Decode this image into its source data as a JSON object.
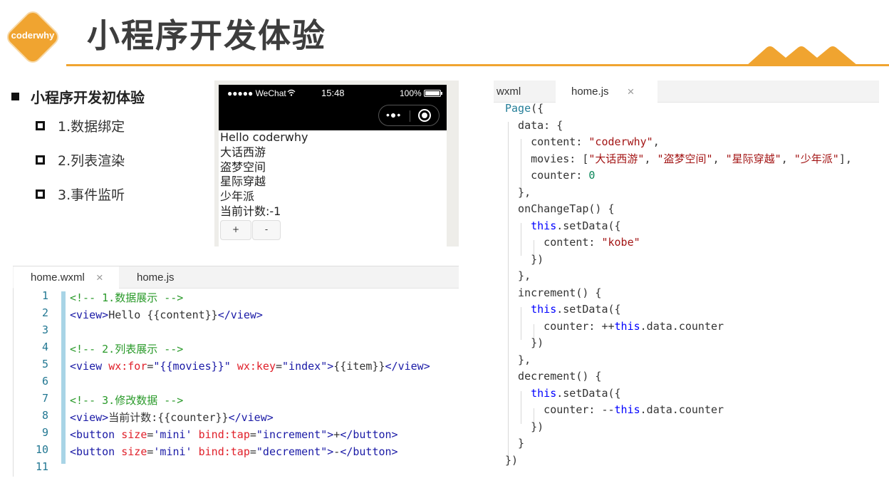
{
  "header": {
    "logo_text": "coderwhy",
    "title": "小程序开发体验",
    "accent_color": "#f0a430"
  },
  "outline": {
    "main": "小程序开发初体验",
    "items": [
      "1.数据绑定",
      "2.列表渲染",
      "3.事件监听"
    ]
  },
  "phone": {
    "carrier": "●●●●● WeChat",
    "wifi_icon": "wifi-icon",
    "time": "15:48",
    "battery": "100%",
    "capsule_dots": "•●•",
    "content_lines": [
      "Hello coderwhy",
      "大话西游",
      "盗梦空间",
      "星际穿越",
      "少年派",
      "当前计数:-1"
    ],
    "buttons": [
      "+",
      "-"
    ]
  },
  "wxml_editor": {
    "tabs": [
      {
        "label": "home.wxml",
        "active": true,
        "close": "×"
      },
      {
        "label": "home.js",
        "active": false
      }
    ],
    "line_numbers": [
      "1",
      "2",
      "3",
      "4",
      "5",
      "6",
      "7",
      "8",
      "9",
      "10",
      "11"
    ],
    "lines": [
      [
        {
          "t": "comment",
          "v": "<!-- 1.数据展示 -->"
        }
      ],
      [
        {
          "t": "tag",
          "v": "<view>"
        },
        {
          "t": "text",
          "v": "Hello {{content}}"
        },
        {
          "t": "tag",
          "v": "</view>"
        }
      ],
      [],
      [
        {
          "t": "comment",
          "v": "<!-- 2.列表展示 -->"
        }
      ],
      [
        {
          "t": "tag",
          "v": "<view "
        },
        {
          "t": "attr",
          "v": "wx:for"
        },
        {
          "t": "text",
          "v": "="
        },
        {
          "t": "str",
          "v": "\"{{movies}}\""
        },
        {
          "t": "text",
          "v": " "
        },
        {
          "t": "attr",
          "v": "wx:key"
        },
        {
          "t": "text",
          "v": "="
        },
        {
          "t": "str",
          "v": "\"index\""
        },
        {
          "t": "tag",
          "v": ">"
        },
        {
          "t": "text",
          "v": "{{item}}"
        },
        {
          "t": "tag",
          "v": "</view>"
        }
      ],
      [],
      [
        {
          "t": "comment",
          "v": "<!-- 3.修改数据 -->"
        }
      ],
      [
        {
          "t": "tag",
          "v": "<view>"
        },
        {
          "t": "text",
          "v": "当前计数:{{counter}}"
        },
        {
          "t": "tag",
          "v": "</view>"
        }
      ],
      [
        {
          "t": "tag",
          "v": "<button "
        },
        {
          "t": "attr",
          "v": "size"
        },
        {
          "t": "text",
          "v": "="
        },
        {
          "t": "str",
          "v": "'mini'"
        },
        {
          "t": "text",
          "v": " "
        },
        {
          "t": "attr",
          "v": "bind:tap"
        },
        {
          "t": "text",
          "v": "="
        },
        {
          "t": "str",
          "v": "\"increment\""
        },
        {
          "t": "tag",
          "v": ">"
        },
        {
          "t": "text",
          "v": "+"
        },
        {
          "t": "tag",
          "v": "</button>"
        }
      ],
      [
        {
          "t": "tag",
          "v": "<button "
        },
        {
          "t": "attr",
          "v": "size"
        },
        {
          "t": "text",
          "v": "="
        },
        {
          "t": "str",
          "v": "'mini'"
        },
        {
          "t": "text",
          "v": " "
        },
        {
          "t": "attr",
          "v": "bind:tap"
        },
        {
          "t": "text",
          "v": "="
        },
        {
          "t": "str",
          "v": "\"decrement\""
        },
        {
          "t": "tag",
          "v": ">"
        },
        {
          "t": "text",
          "v": "-"
        },
        {
          "t": "tag",
          "v": "</button>"
        }
      ],
      []
    ]
  },
  "js_editor": {
    "tabs": [
      {
        "label": "wxml",
        "active": false
      },
      {
        "label": "home.js",
        "active": true,
        "close": "×"
      }
    ],
    "lines": [
      [
        {
          "t": "fn",
          "v": "Page"
        },
        {
          "t": "text",
          "v": "({"
        }
      ],
      [
        {
          "t": "text",
          "v": "  data: {"
        }
      ],
      [
        {
          "t": "text",
          "v": "    content: "
        },
        {
          "t": "jsstr",
          "v": "\"coderwhy\""
        },
        {
          "t": "text",
          "v": ","
        }
      ],
      [
        {
          "t": "text",
          "v": "    movies: ["
        },
        {
          "t": "jsstr",
          "v": "\"大话西游\""
        },
        {
          "t": "text",
          "v": ", "
        },
        {
          "t": "jsstr",
          "v": "\"盗梦空间\""
        },
        {
          "t": "text",
          "v": ", "
        },
        {
          "t": "jsstr",
          "v": "\"星际穿越\""
        },
        {
          "t": "text",
          "v": ", "
        },
        {
          "t": "jsstr",
          "v": "\"少年派\""
        },
        {
          "t": "text",
          "v": "],"
        }
      ],
      [
        {
          "t": "text",
          "v": "    counter: "
        },
        {
          "t": "num",
          "v": "0"
        }
      ],
      [
        {
          "t": "text",
          "v": "  },"
        }
      ],
      [
        {
          "t": "text",
          "v": "  onChangeTap() {"
        }
      ],
      [
        {
          "t": "text",
          "v": "    "
        },
        {
          "t": "kw",
          "v": "this"
        },
        {
          "t": "text",
          "v": ".setData({"
        }
      ],
      [
        {
          "t": "text",
          "v": "      content: "
        },
        {
          "t": "jsstr",
          "v": "\"kobe\""
        }
      ],
      [
        {
          "t": "text",
          "v": "    })"
        }
      ],
      [
        {
          "t": "text",
          "v": "  },"
        }
      ],
      [
        {
          "t": "text",
          "v": "  increment() {"
        }
      ],
      [
        {
          "t": "text",
          "v": "    "
        },
        {
          "t": "kw",
          "v": "this"
        },
        {
          "t": "text",
          "v": ".setData({"
        }
      ],
      [
        {
          "t": "text",
          "v": "      counter: ++"
        },
        {
          "t": "kw",
          "v": "this"
        },
        {
          "t": "text",
          "v": ".data.counter"
        }
      ],
      [
        {
          "t": "text",
          "v": "    })"
        }
      ],
      [
        {
          "t": "text",
          "v": "  },"
        }
      ],
      [
        {
          "t": "text",
          "v": "  decrement() {"
        }
      ],
      [
        {
          "t": "text",
          "v": "    "
        },
        {
          "t": "kw",
          "v": "this"
        },
        {
          "t": "text",
          "v": ".setData({"
        }
      ],
      [
        {
          "t": "text",
          "v": "      counter: --"
        },
        {
          "t": "kw",
          "v": "this"
        },
        {
          "t": "text",
          "v": ".data.counter"
        }
      ],
      [
        {
          "t": "text",
          "v": "    })"
        }
      ],
      [
        {
          "t": "text",
          "v": "  }"
        }
      ],
      [
        {
          "t": "text",
          "v": "})"
        }
      ]
    ]
  }
}
